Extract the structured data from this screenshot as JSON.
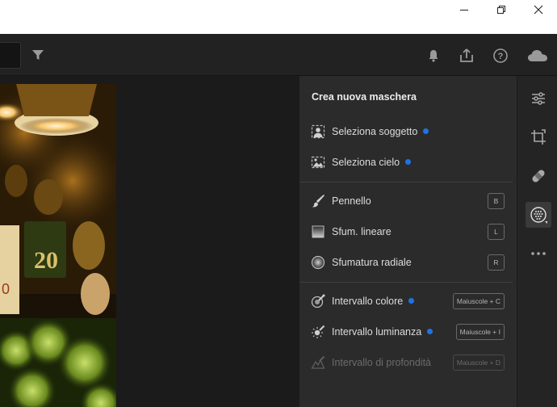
{
  "window": {
    "minimize_icon": "minimize-icon",
    "maximize_icon": "restore-icon",
    "close_icon": "close-icon"
  },
  "header": {
    "icons": [
      "filter-icon",
      "bell-icon",
      "share-icon",
      "help-icon",
      "cloud-icon"
    ]
  },
  "mask_panel": {
    "title": "Crea nuova maschera",
    "items": [
      {
        "label": "Seleziona soggetto",
        "icon": "subject-icon",
        "new": true
      },
      {
        "label": "Seleziona cielo",
        "icon": "sky-icon",
        "new": true
      },
      {
        "label": "Pennello",
        "icon": "brush-icon",
        "shortcut": "B"
      },
      {
        "label": "Sfum. lineare",
        "icon": "linear-gradient-icon",
        "shortcut": "L"
      },
      {
        "label": "Sfumatura radiale",
        "icon": "radial-gradient-icon",
        "shortcut": "R"
      },
      {
        "label": "Intervallo colore",
        "icon": "color-range-icon",
        "new": true,
        "shortcut": "Maiuscole + C"
      },
      {
        "label": "Intervallo luminanza",
        "icon": "luminance-range-icon",
        "new": true,
        "shortcut": "Maiuscole + I"
      },
      {
        "label": "Intervallo di profondità",
        "icon": "depth-range-icon",
        "shortcut": "Maiuscole + D",
        "disabled": true
      }
    ]
  },
  "toolstrip": {
    "tools": [
      "edit-sliders-icon",
      "crop-icon",
      "healing-icon",
      "masking-icon",
      "more-icon"
    ],
    "active": "masking-icon"
  },
  "colors": {
    "accent": "#1e73e8",
    "panel_bg": "#2b2b2b",
    "header_bg": "#222222"
  }
}
